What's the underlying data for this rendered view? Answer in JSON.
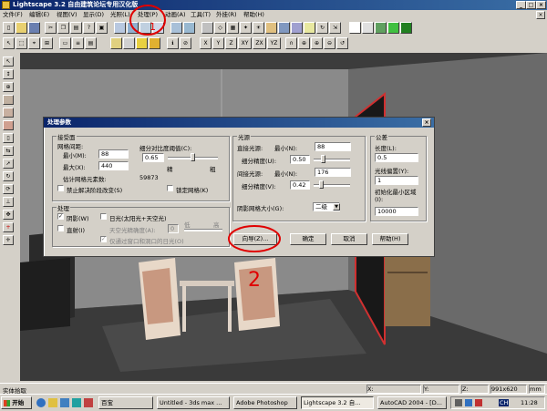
{
  "app": {
    "title": "Lightscape 3.2 自由建筑论坛专用汉化版",
    "window_buttons": [
      "_",
      "□",
      "×"
    ]
  },
  "menu": [
    "文件(F)",
    "编辑(E)",
    "视图(V)",
    "显示(D)",
    "光照(L)",
    "处理(P)",
    "动画(A)",
    "工具(T)",
    "外挂(R)",
    "帮助(H)"
  ],
  "toolbar_axes": [
    "X",
    "Y",
    "Z",
    "XY",
    "ZX",
    "YZ"
  ],
  "dialog": {
    "title": "处理参数",
    "close": "×",
    "surface": {
      "group": "接受面",
      "mesh_spacing": "网格间距:",
      "min_label": "最小(M):",
      "min_value": "88",
      "max_label": "最大(X):",
      "max_value": "440",
      "estimate_label": "估计网格元素数:",
      "estimate_value": "59873",
      "subdiv_label": "细分对比度阈值(C):",
      "subdiv_value": "0.65",
      "fine": "精",
      "coarse": "粗",
      "no_subdiv": "禁止解决阶段改变(S)",
      "lock_mesh": "锁定网格(K)"
    },
    "process": {
      "group": "处理",
      "shadow": "阴影(W)",
      "shadow_checked": true,
      "daylight": "日光(太阳光+天空光)",
      "daylight_checked": false,
      "direct": "直射(I)",
      "direct_checked": false,
      "sky_precision": "天空光精确度(A):",
      "sky_value": "0",
      "low": "低",
      "high": "高",
      "windows_only": "仅通过窗口和洞口的日光(O)",
      "windows_checked": true
    },
    "transfer": {
      "group": "光源",
      "direct_transfer": "直接光源:",
      "min": "最小(N):",
      "direct_min": "88",
      "direct_subdiv": "细分精度(U):",
      "direct_subdiv_value": "0.50",
      "indirect_transfer": "间接光源:",
      "indirect_min": "176",
      "indirect_subdiv": "细分精度(V):",
      "indirect_subdiv_value": "0.42",
      "shadow_grid": "阴影网格大小(G):",
      "shadow_grid_value": "二级"
    },
    "tolerance": {
      "group": "公差",
      "length": "长度(L):",
      "length_value": "0.5",
      "ray_offset": "光线偏置(Y):",
      "ray_value": "1",
      "init_mesh": "初始化最小区域(I):",
      "init_value": "10000"
    },
    "buttons": {
      "wizard": "向导(Z)...",
      "ok": "确定",
      "cancel": "取消",
      "help": "帮助(H)"
    }
  },
  "annotation": "2",
  "status": {
    "left": "实体拾取",
    "x": "X:",
    "y": "Y:",
    "z": "Z:",
    "size": "991x620",
    "mm": "mm"
  },
  "taskbar": {
    "start": "开始",
    "tasks": [
      "百宝",
      "Untitled - 3ds max ...",
      "Adobe Photoshop",
      "Lightscape 3.2 自...",
      "AutoCAD 2004 - [D..."
    ],
    "clock": "11:28",
    "ime": "CH"
  }
}
